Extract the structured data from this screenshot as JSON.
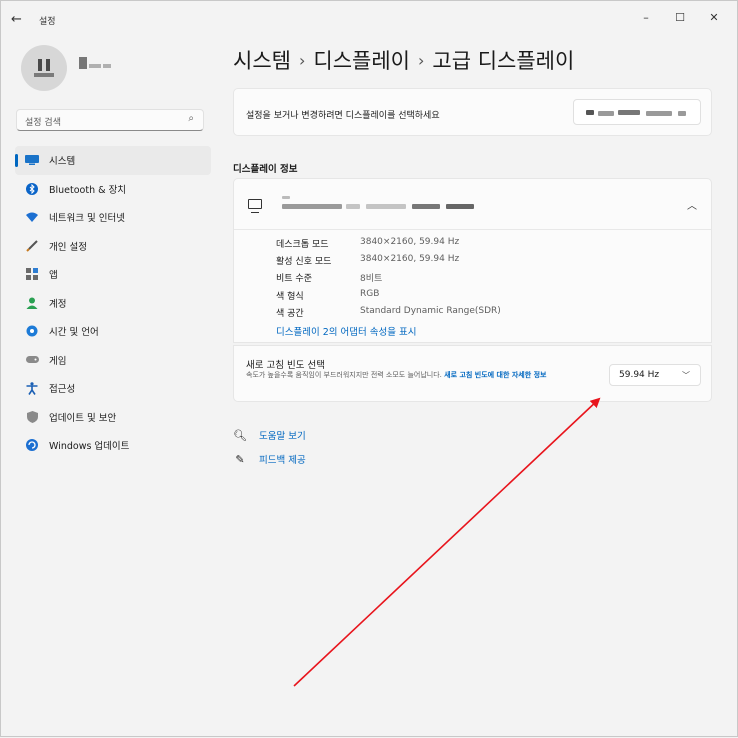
{
  "window": {
    "title": "설정",
    "back": "←",
    "controls": {
      "minimize": "–",
      "maximize": "☐",
      "close": "✕"
    }
  },
  "search": {
    "placeholder": "설정 검색",
    "icon": "search-icon"
  },
  "sidebar": {
    "items": [
      {
        "label": "시스템",
        "icon": "system-icon",
        "selected": true
      },
      {
        "label": "Bluetooth & 장치",
        "icon": "bluetooth-icon"
      },
      {
        "label": "네트워크 및 인터넷",
        "icon": "network-icon"
      },
      {
        "label": "개인 설정",
        "icon": "brush-icon"
      },
      {
        "label": "앱",
        "icon": "apps-icon"
      },
      {
        "label": "계정",
        "icon": "account-icon"
      },
      {
        "label": "시간 및 언어",
        "icon": "globe-icon"
      },
      {
        "label": "게임",
        "icon": "gamepad-icon"
      },
      {
        "label": "접근성",
        "icon": "accessibility-icon"
      },
      {
        "label": "업데이트 및 보안",
        "icon": "shield-icon"
      },
      {
        "label": "Windows 업데이트",
        "icon": "update-icon"
      }
    ]
  },
  "breadcrumb": {
    "parts": [
      "시스템",
      "디스플레이",
      "고급 디스플레이"
    ],
    "separator": "›"
  },
  "select_display": {
    "label": "설정을 보거나 변경하려면 디스플레이를 선택하세요"
  },
  "display_info": {
    "section_title": "디스플레이 정보",
    "rows": [
      {
        "key": "데스크톱 모드",
        "value": "3840×2160, 59.94 Hz"
      },
      {
        "key": "활성 신호 모드",
        "value": "3840×2160, 59.94 Hz"
      },
      {
        "key": "비트 수준",
        "value": "8비트"
      },
      {
        "key": "색 형식",
        "value": "RGB"
      },
      {
        "key": "색 공간",
        "value": "Standard Dynamic Range(SDR)"
      }
    ],
    "adapter_link": "디스플레이 2의 어댑터 속성을 표시"
  },
  "refresh_rate": {
    "title": "새로 고침 빈도 선택",
    "description": "속도가 높을수록 움직임이 부드러워지지만 전력 소모도 늘어납니다.",
    "more_link": "새로 고침 빈도에 대한 자세한 정보",
    "value": "59.94 Hz"
  },
  "help": {
    "get_help": "도움말 보기",
    "feedback": "피드백 제공"
  },
  "colors": {
    "accent": "#0067c0",
    "annotation_arrow": "#e8141c"
  }
}
